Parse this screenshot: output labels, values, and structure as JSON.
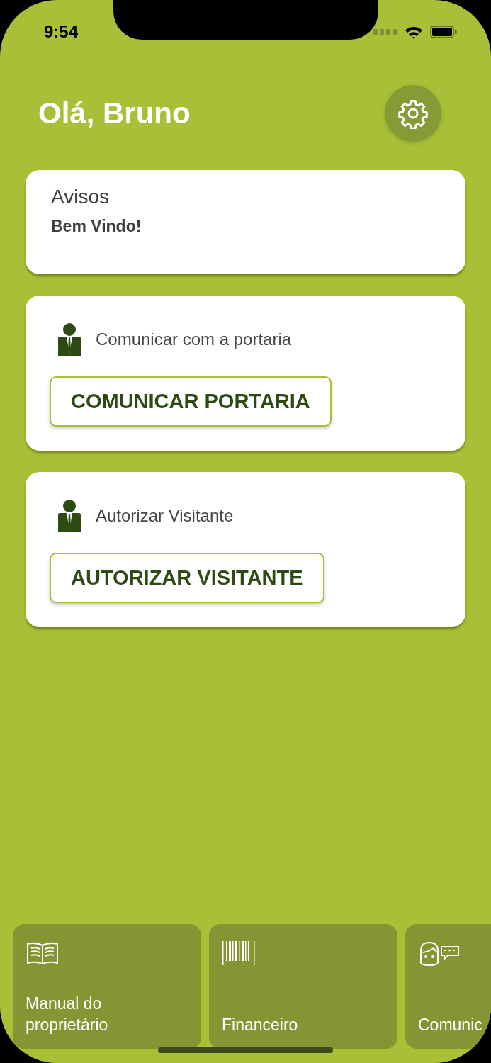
{
  "status_bar": {
    "time": "9:54"
  },
  "greeting": "Olá, Bruno",
  "notices": {
    "title": "Avisos",
    "message": "Bem Vindo!"
  },
  "action_cards": [
    {
      "label": "Comunicar com a portaria",
      "button": "COMUNICAR PORTARIA"
    },
    {
      "label": "Autorizar Visitante",
      "button": "AUTORIZAR VISITANTE"
    }
  ],
  "shortcuts": [
    {
      "kind": "book",
      "label": "Manual do proprietário"
    },
    {
      "kind": "barcode",
      "label": "Financeiro"
    },
    {
      "kind": "chat",
      "label": "Comunic"
    }
  ]
}
